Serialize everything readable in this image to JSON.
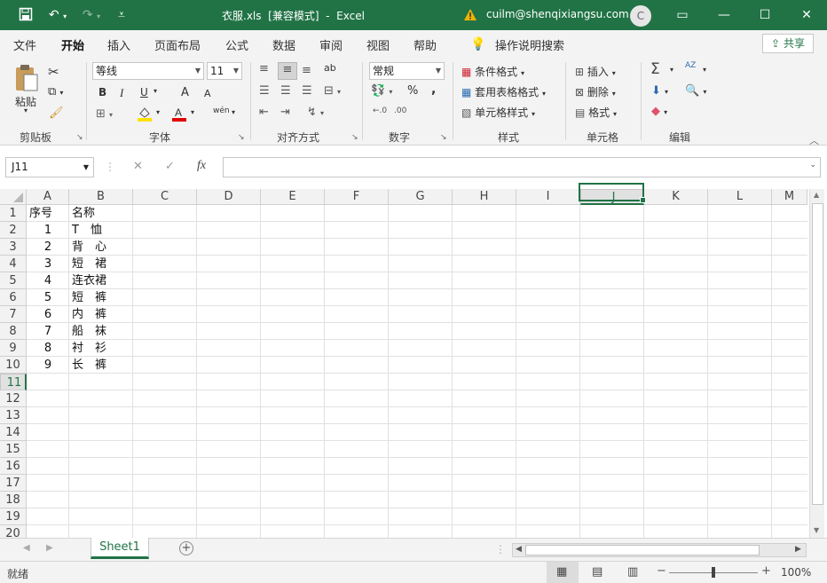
{
  "app": {
    "filename": "衣服.xls",
    "mode": "[兼容模式]",
    "app_name": "Excel",
    "user": "cuilm@shenqixiangsu.com",
    "avatar_letter": "C",
    "title_sep": "-"
  },
  "colors": {
    "accent": "#217346",
    "warning": "#f0b400",
    "font_color_bar": "#e00000",
    "fill_bar": "#ffe100"
  },
  "menu": {
    "tabs": [
      "文件",
      "开始",
      "插入",
      "页面布局",
      "公式",
      "数据",
      "审阅",
      "视图",
      "帮助"
    ],
    "active_tab": "开始",
    "tell_me": "操作说明搜索",
    "share": "共享"
  },
  "ribbon": {
    "clipboard": {
      "paste": "粘贴",
      "label": "剪贴板"
    },
    "font": {
      "name": "等线",
      "size": "11",
      "label": "字体",
      "bold": "B",
      "italic": "I",
      "underline": "U",
      "grow": "A",
      "shrink": "A",
      "phonetic": "wén"
    },
    "alignment": {
      "label": "对齐方式",
      "wrap": "ab"
    },
    "number": {
      "format": "常规",
      "label": "数字",
      "percent": "%",
      "comma": ","
    },
    "styles": {
      "conditional": "条件格式",
      "table": "套用表格格式",
      "cell": "单元格样式",
      "label": "样式"
    },
    "cells": {
      "insert": "插入",
      "delete": "删除",
      "format": "格式",
      "label": "单元格"
    },
    "editing": {
      "label": "编辑",
      "sum": "Σ",
      "sort": "AZ"
    }
  },
  "formula_bar": {
    "name_box": "J11",
    "fx": "fx",
    "cancel": "✕",
    "confirm": "✓",
    "value": ""
  },
  "sheet": {
    "columns": [
      "A",
      "B",
      "C",
      "D",
      "E",
      "F",
      "G",
      "H",
      "I",
      "J",
      "K",
      "L",
      "M"
    ],
    "rows": [
      "1",
      "2",
      "3",
      "4",
      "5",
      "6",
      "7",
      "8",
      "9",
      "10",
      "11",
      "12",
      "13",
      "14",
      "15",
      "16",
      "17",
      "18",
      "19",
      "20"
    ],
    "selected_column": "J",
    "selected_row": "11",
    "cells": [
      [
        "序号",
        "名称"
      ],
      [
        "1",
        "T　恤"
      ],
      [
        "2",
        "背　心"
      ],
      [
        "3",
        "短　裙"
      ],
      [
        "4",
        "连衣裙"
      ],
      [
        "5",
        "短　裤"
      ],
      [
        "6",
        "内　裤"
      ],
      [
        "7",
        "船　袜"
      ],
      [
        "8",
        "衬　衫"
      ],
      [
        "9",
        "长　裤"
      ]
    ]
  },
  "tabs_bar": {
    "sheet_name": "Sheet1",
    "add": "+"
  },
  "status": {
    "ready": "就绪",
    "zoom": "100%",
    "zoom_minus": "−",
    "zoom_plus": "+",
    "zoom_level": 0.5
  }
}
